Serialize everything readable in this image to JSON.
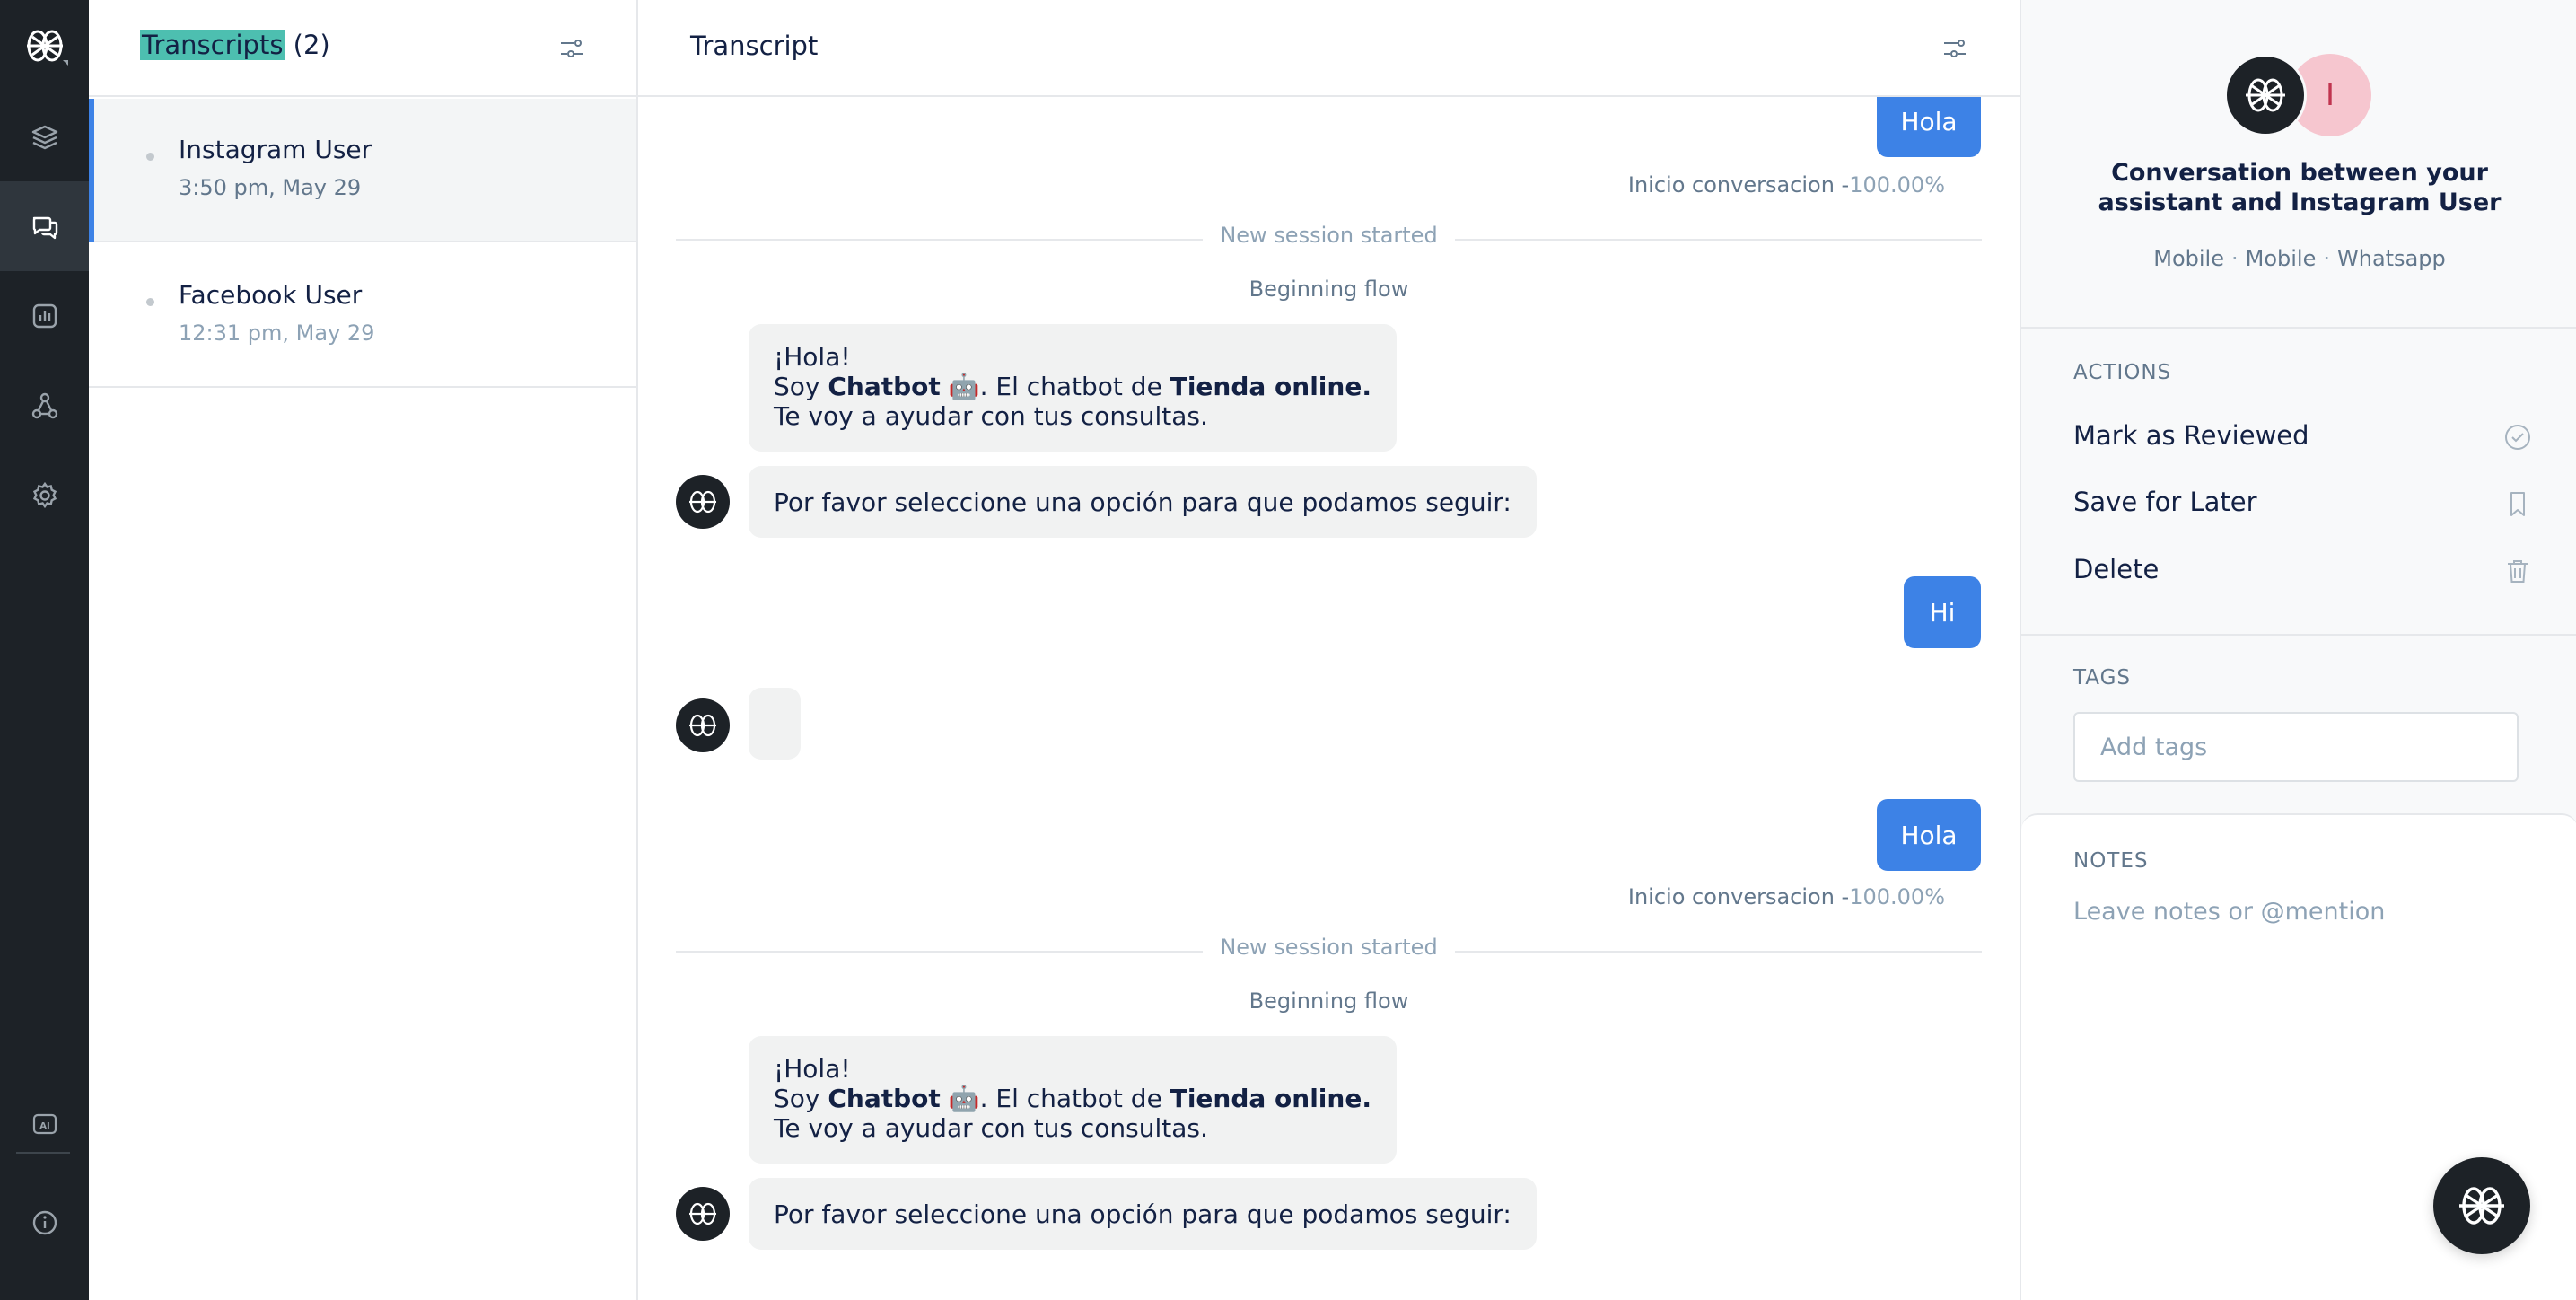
{
  "nav": {
    "items": [
      "logo-icon",
      "layers-icon",
      "chat-icon",
      "analytics-icon",
      "flow-icon",
      "settings-icon",
      "ai-icon",
      "info-icon"
    ]
  },
  "list": {
    "title_highlight": "Transcripts",
    "title_count": "(2)",
    "items": [
      {
        "name": "Instagram User",
        "time": "3:50 pm, May 29"
      },
      {
        "name": "Facebook User",
        "time": "12:31 pm, May 29"
      }
    ]
  },
  "transcript": {
    "title": "Transcript",
    "messages": {
      "hola_1": "Hola",
      "meta_label": "Inicio conversacion -",
      "meta_pct": "100.00%",
      "session": "New session started",
      "flow": "Beginning flow",
      "greet_l1": "¡Hola!",
      "greet_soy": "Soy ",
      "greet_bot": "Chatbot",
      "greet_emoji": " 🤖",
      "greet_mid": ". El chatbot de ",
      "greet_store": "Tienda online.",
      "greet_l3": "Te voy a ayudar con tus consultas.",
      "prompt": "Por favor seleccione una opción para que podamos seguir:",
      "hi": "Hi",
      "hola_2": "Hola"
    }
  },
  "sidebar": {
    "title": "Conversation between your assistant and Instagram User",
    "user_initial": "I",
    "meta": [
      "Mobile",
      "Mobile",
      "Whatsapp"
    ],
    "meta_sep": "·",
    "actions_label": "ACTIONS",
    "actions": [
      "Mark as Reviewed",
      "Save for Later",
      "Delete"
    ],
    "tags_label": "TAGS",
    "tags_placeholder": "Add tags",
    "notes_label": "NOTES",
    "notes_placeholder": "Leave notes or @mention"
  },
  "colors": {
    "accent": "#3d82e6",
    "highlight": "#4dbfb0",
    "rail": "#1d2227"
  }
}
